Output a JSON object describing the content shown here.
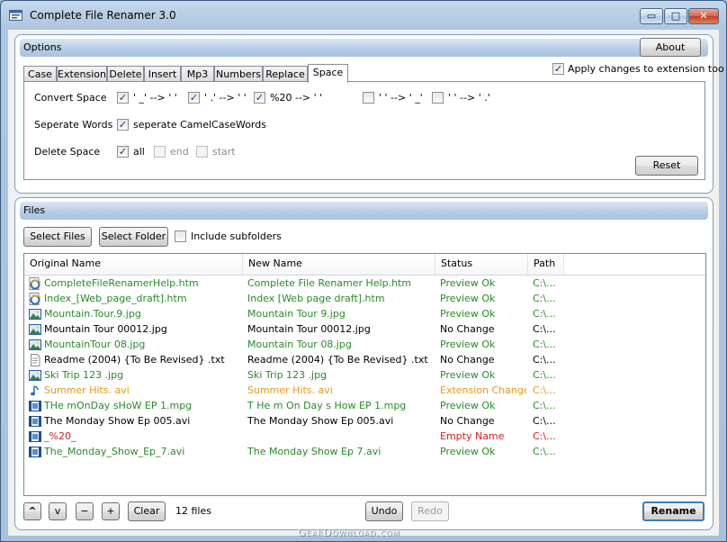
{
  "colors": {
    "preview_ok": "#2a8a2a",
    "no_change": "#000000",
    "extension_changed": "#e69a1a",
    "empty_name": "#d42020",
    "summer_name": "#e69a1a"
  },
  "window": {
    "title": "Complete File Renamer 3.0",
    "minimize": "▭",
    "maximize": "□",
    "close": "✕"
  },
  "options": {
    "header": "Options",
    "about_label": "About",
    "tabs": [
      {
        "label": "Case"
      },
      {
        "label": "Extension"
      },
      {
        "label": "Delete"
      },
      {
        "label": "Insert"
      },
      {
        "label": "Mp3"
      },
      {
        "label": "Numbers"
      },
      {
        "label": "Replace"
      },
      {
        "label": "Space"
      }
    ],
    "active_tab": "Space",
    "apply_ext_label": "Apply changes to extension too",
    "apply_ext_checked": true,
    "convert_space_label": "Convert Space",
    "convert_options": [
      {
        "label": "' _' -->  '  '",
        "checked": true
      },
      {
        "label": "' .' -->  '  '",
        "checked": true
      },
      {
        "label": "%20 -->  '  '",
        "checked": true
      },
      {
        "label": "'  ' --> ' _'",
        "checked": false
      },
      {
        "label": "'  ' --> ' .'",
        "checked": false
      }
    ],
    "separate_words_label": "Seperate Words",
    "separate_camel_label": "seperate CamelCaseWords",
    "separate_camel_checked": true,
    "delete_space_label": "Delete Space",
    "delete_all_label": "all",
    "delete_all_checked": true,
    "delete_end_label": "end",
    "delete_start_label": "start",
    "reset_label": "Reset"
  },
  "files": {
    "header": "Files",
    "select_files_label": "Select Files",
    "select_folder_label": "Select Folder",
    "include_subfolders_label": "Include subfolders",
    "include_subfolders_checked": false,
    "columns": {
      "original": "Original Name",
      "new": "New Name",
      "status": "Status",
      "path": "Path"
    },
    "rows": [
      {
        "icon": "ie",
        "original": "CompleteFileRenamerHelp.htm",
        "new": "Complete File Renamer Help.htm",
        "status": "Preview Ok",
        "path": "C:\\...",
        "color": "#2a8a2a"
      },
      {
        "icon": "ie",
        "original": "Index_[Web_page_draft].htm",
        "new": "Index [Web page draft].htm",
        "status": "Preview Ok",
        "path": "C:\\...",
        "color": "#2a8a2a"
      },
      {
        "icon": "image",
        "original": "Mountain.Tour.9.jpg",
        "new": "Mountain Tour 9.jpg",
        "status": "Preview Ok",
        "path": "C:\\...",
        "color": "#2a8a2a"
      },
      {
        "icon": "image",
        "original": "Mountain Tour 00012.jpg",
        "new": "Mountain Tour 00012.jpg",
        "status": "No Change",
        "path": "C:\\...",
        "color": "#000000"
      },
      {
        "icon": "image",
        "original": "MountainTour 08.jpg",
        "new": "Mountain Tour 08.jpg",
        "status": "Preview Ok",
        "path": "C:\\...",
        "color": "#2a8a2a"
      },
      {
        "icon": "text",
        "original": "Readme (2004) {To Be Revised} .txt",
        "new": "Readme (2004) {To Be Revised} .txt",
        "status": "No Change",
        "path": "C:\\...",
        "color": "#000000"
      },
      {
        "icon": "image",
        "original": "Ski    Trip     123    .jpg",
        "new": "Ski Trip 123 .jpg",
        "status": "Preview Ok",
        "path": "C:\\...",
        "color": "#2a8a2a"
      },
      {
        "icon": "music",
        "original": "Summer Hits.  avi",
        "new": "Summer Hits. avi",
        "status": "Extension Changed",
        "path": "C:\\...",
        "color": "#e69a1a"
      },
      {
        "icon": "video",
        "original": "THe mOnDay sHoW EP 1.mpg",
        "new": "T He m On Day s How EP 1.mpg",
        "status": "Preview Ok",
        "path": "C:\\...",
        "color": "#2a8a2a"
      },
      {
        "icon": "video",
        "original": "The Monday Show Ep 005.avi",
        "new": "The Monday Show Ep 005.avi",
        "status": "No Change",
        "path": "C:\\...",
        "color": "#000000"
      },
      {
        "icon": "video",
        "original": "_%20_",
        "new": "",
        "status": "Empty Name",
        "path": "C:\\...",
        "color": "#d42020"
      },
      {
        "icon": "video",
        "original": "The_Monday_Show_Ep_7.avi",
        "new": "The Monday Show Ep 7.avi",
        "status": "Preview Ok",
        "path": "C:\\...",
        "color": "#2a8a2a"
      }
    ]
  },
  "bottom": {
    "up_label": "^",
    "down_label": "v",
    "minus_label": "−",
    "plus_label": "+",
    "clear_label": "Clear",
    "file_count": "12 files",
    "undo_label": "Undo",
    "redo_label": "Redo",
    "rename_label": "Rename"
  },
  "watermark": "GearDownload.com"
}
